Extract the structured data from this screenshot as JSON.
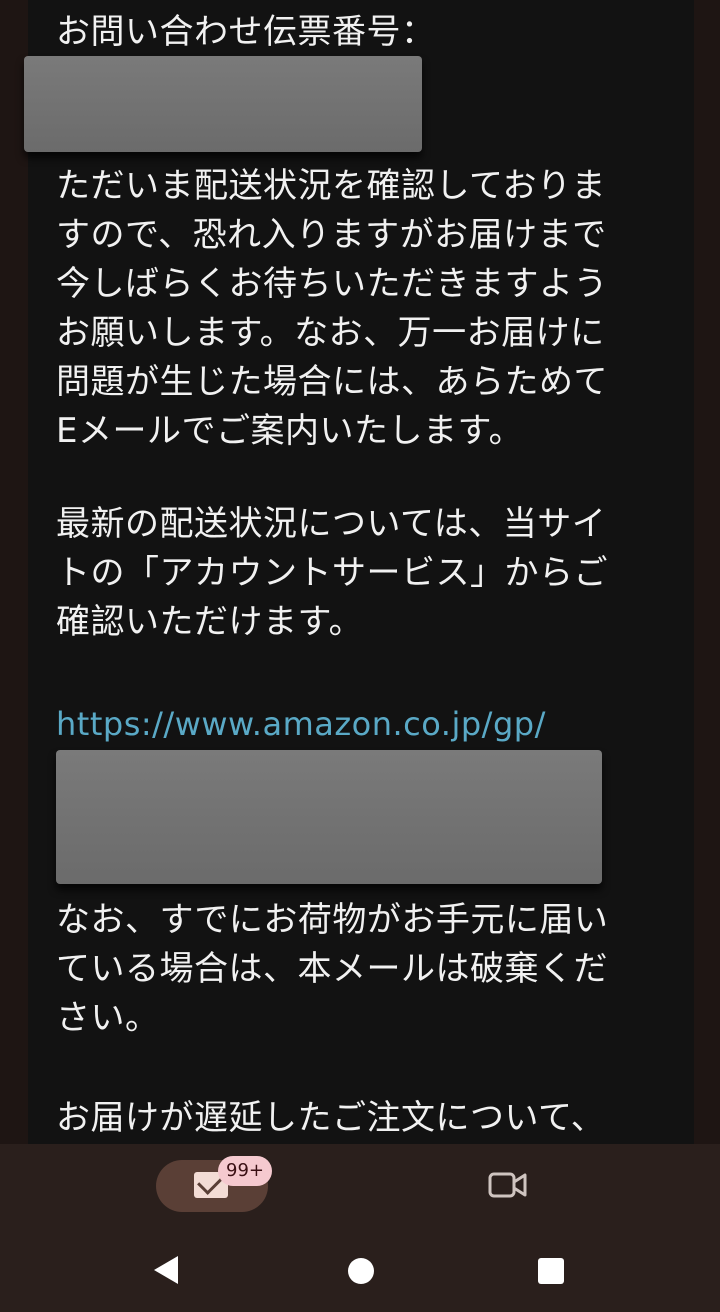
{
  "email": {
    "lines_top": [
      "お問い合わせ伝票番号："
    ],
    "para1": [
      "ただいま配送状況を確認しておりま",
      "すので、恐れ入りますがお届けまで",
      "今しばらくお待ちいただきますよう",
      "お願いします。なお、万一お届けに",
      "問題が生じた場合には、あらためて",
      "Eメールでご案内いたします。"
    ],
    "para2": [
      "最新の配送状況については、当サイ",
      "トの「アカウントサービス」からご",
      "確認いただけます。"
    ],
    "link": "https://www.amazon.co.jp/gp/",
    "para3": [
      "なお、すでにお荷物がお手元に届い",
      "ている場合は、本メールは破棄くだ",
      "さい。"
    ],
    "para4": [
      "お届けが遅延したご注文について、"
    ]
  },
  "bottom_nav": {
    "mail_badge": "99+"
  },
  "colors": {
    "background": "#121212",
    "text": "#f1f1f1",
    "link": "#5aa9c6",
    "nav": "#2a1f1c",
    "pill": "#5a3f36",
    "badge": "#f5c9cf"
  }
}
